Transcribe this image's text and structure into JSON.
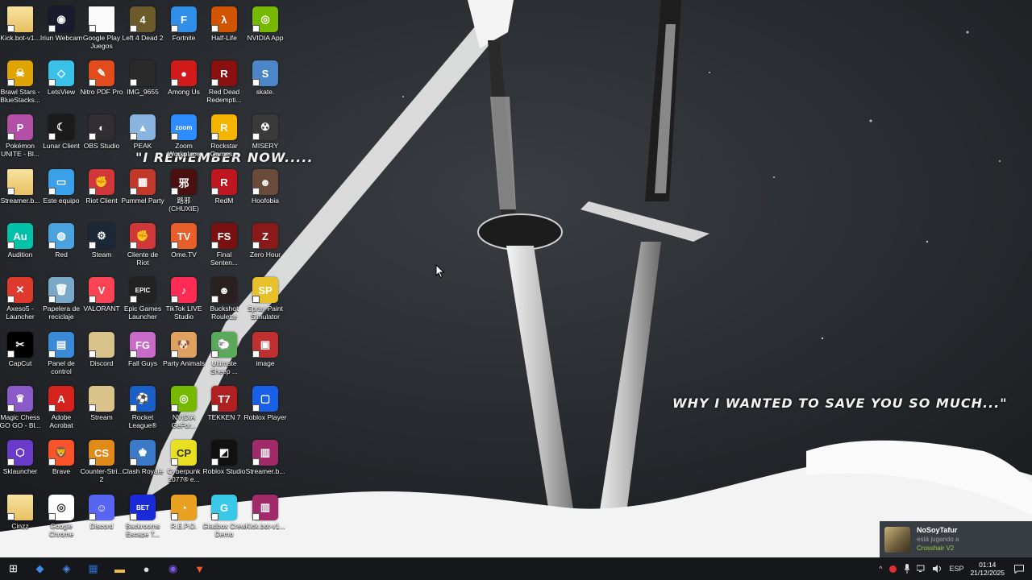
{
  "wallpaper": {
    "quote_top": "\"I REMEMBER NOW.....",
    "quote_bottom": "WHY I WANTED TO SAVE YOU SO MUCH...\""
  },
  "desktop_icons": [
    {
      "label": "Kick.bot-v1...",
      "color": "#f5d98b",
      "glyph": "",
      "icon": "folder-icon"
    },
    {
      "label": "Iriun Webcam",
      "color": "#1a1a2e",
      "glyph": "◉",
      "icon": "webcam-icon"
    },
    {
      "label": "Google Play Juegos",
      "color": "#ffffff",
      "glyph": "",
      "icon": "file-icon"
    },
    {
      "label": "Left 4 Dead 2",
      "color": "#6b5a2a",
      "glyph": "4",
      "icon": "left4dead-icon"
    },
    {
      "label": "Fortnite",
      "color": "#2f8fe8",
      "glyph": "F",
      "icon": "fortnite-icon"
    },
    {
      "label": "Half-Life",
      "color": "#d35400",
      "glyph": "λ",
      "icon": "halflife-icon"
    },
    {
      "label": "NVIDIA App",
      "color": "#76b900",
      "glyph": "◎",
      "icon": "nvidia-icon"
    },
    {
      "label": "Brawl Stars - BlueStacks...",
      "color": "#e0a400",
      "glyph": "☠",
      "icon": "brawlstars-icon"
    },
    {
      "label": "LetsView",
      "color": "#3ac1e8",
      "glyph": "◇",
      "icon": "letsview-icon"
    },
    {
      "label": "Nitro PDF Pro",
      "color": "#e24b1c",
      "glyph": "✎",
      "icon": "nitro-icon"
    },
    {
      "label": "IMG_9655",
      "color": "#2a2a2a",
      "glyph": "",
      "icon": "image-file-icon"
    },
    {
      "label": "Among Us",
      "color": "#d11b1b",
      "glyph": "●",
      "icon": "amongus-icon"
    },
    {
      "label": "Red Dead Redempti...",
      "color": "#8a1010",
      "glyph": "R",
      "icon": "reddead-icon"
    },
    {
      "label": "skate.",
      "color": "#4a86c8",
      "glyph": "S",
      "icon": "skate-icon"
    },
    {
      "label": "Pokémon UNITE - Bl...",
      "color": "#b44fa8",
      "glyph": "P",
      "icon": "pokemon-icon"
    },
    {
      "label": "Lunar Client",
      "color": "#1b1b1b",
      "glyph": "☾",
      "icon": "lunar-icon"
    },
    {
      "label": "OBS Studio",
      "color": "#302e31",
      "glyph": "◐",
      "icon": "obs-icon"
    },
    {
      "label": "PEAK",
      "color": "#8ab4e0",
      "glyph": "▲",
      "icon": "peak-icon"
    },
    {
      "label": "Zoom Workplace",
      "color": "#2d8cff",
      "glyph": "zoom",
      "icon": "zoom-icon"
    },
    {
      "label": "Rockstar Games...",
      "color": "#f4b400",
      "glyph": "R",
      "icon": "rockstar-icon"
    },
    {
      "label": "MISERY",
      "color": "#3a3a3a",
      "glyph": "☢",
      "icon": "misery-icon"
    },
    {
      "label": "Streamer.b...",
      "color": "#f5d98b",
      "glyph": "",
      "icon": "folder-icon"
    },
    {
      "label": "Este equipo",
      "color": "#3aa0e8",
      "glyph": "▭",
      "icon": "computer-icon"
    },
    {
      "label": "Riot Client",
      "color": "#d13639",
      "glyph": "✊",
      "icon": "riot-icon"
    },
    {
      "label": "Pummel Party",
      "color": "#c0392b",
      "glyph": "▦",
      "icon": "pummel-icon"
    },
    {
      "label": "路邪 (CHUXIE)",
      "color": "#4a1010",
      "glyph": "邪",
      "icon": "chuxie-icon"
    },
    {
      "label": "RedM",
      "color": "#c0161f",
      "glyph": "R",
      "icon": "redm-icon"
    },
    {
      "label": "Hoofobia",
      "color": "#6a4a3a",
      "glyph": "☻",
      "icon": "hoofobia-icon"
    },
    {
      "label": "Audition",
      "color": "#00c2a8",
      "glyph": "Au",
      "icon": "audition-icon"
    },
    {
      "label": "Red",
      "color": "#4aa3df",
      "glyph": "◍",
      "icon": "network-icon"
    },
    {
      "label": "Steam",
      "color": "#1b2838",
      "glyph": "⚙",
      "icon": "steam-icon"
    },
    {
      "label": "Cliente de Riot",
      "color": "#d13639",
      "glyph": "✊",
      "icon": "riot-icon"
    },
    {
      "label": "Ome.TV",
      "color": "#e85d2a",
      "glyph": "TV",
      "icon": "ometv-icon"
    },
    {
      "label": "Final Senten...",
      "color": "#7a1010",
      "glyph": "FS",
      "icon": "finalsentence-icon"
    },
    {
      "label": "Zero Hour",
      "color": "#8a1a1a",
      "glyph": "Z",
      "icon": "zerohour-icon"
    },
    {
      "label": "Axeso5 - Launcher",
      "color": "#e03a2e",
      "glyph": "✕",
      "icon": "axeso5-icon"
    },
    {
      "label": "Papelera de reciclaje",
      "color": "#7aa8c8",
      "glyph": "🗑",
      "icon": "recycle-bin-icon"
    },
    {
      "label": "VALORANT",
      "color": "#fa4454",
      "glyph": "V",
      "icon": "valorant-icon"
    },
    {
      "label": "Epic Games Launcher",
      "color": "#222222",
      "glyph": "EPIC",
      "icon": "epic-icon"
    },
    {
      "label": "TikTok LIVE Studio",
      "color": "#fe2c55",
      "glyph": "♪",
      "icon": "tiktok-icon"
    },
    {
      "label": "Buckshot Roulette",
      "color": "#2a2020",
      "glyph": "☻",
      "icon": "buckshot-icon"
    },
    {
      "label": "Spray Paint Simulator",
      "color": "#e8c02a",
      "glyph": "SP",
      "icon": "spraypaint-icon"
    },
    {
      "label": "CapCut",
      "color": "#000000",
      "glyph": "✂",
      "icon": "capcut-icon"
    },
    {
      "label": "Panel de control",
      "color": "#3a8ad8",
      "glyph": "▤",
      "icon": "control-panel-icon"
    },
    {
      "label": "Discord",
      "color": "#d9c38a",
      "glyph": "",
      "icon": "archive-icon"
    },
    {
      "label": "Fall Guys",
      "color": "#c86ac8",
      "glyph": "FG",
      "icon": "fallguys-icon"
    },
    {
      "label": "Party Animals",
      "color": "#e0a060",
      "glyph": "🐶",
      "icon": "partyanimals-icon"
    },
    {
      "label": "Ultimate Sheep ...",
      "color": "#5aa85a",
      "glyph": "🐑",
      "icon": "sheep-icon"
    },
    {
      "label": "image",
      "color": "#c03030",
      "glyph": "▣",
      "icon": "image-icon"
    },
    {
      "label": "Magic Chess GO GO - Bl...",
      "color": "#8a5ac8",
      "glyph": "♛",
      "icon": "magicchess-icon"
    },
    {
      "label": "Adobe Acrobat",
      "color": "#d4231c",
      "glyph": "A",
      "icon": "acrobat-icon"
    },
    {
      "label": "Stream",
      "color": "#d9c38a",
      "glyph": "",
      "icon": "archive-icon"
    },
    {
      "label": "Rocket League®",
      "color": "#1a5fc8",
      "glyph": "⚽",
      "icon": "rocketleague-icon"
    },
    {
      "label": "NVIDIA GeFor...",
      "color": "#76b900",
      "glyph": "◎",
      "icon": "geforce-icon"
    },
    {
      "label": "TEKKEN 7",
      "color": "#b02020",
      "glyph": "T7",
      "icon": "tekken-icon"
    },
    {
      "label": "Roblox Player",
      "color": "#1a5fe8",
      "glyph": "▢",
      "icon": "roblox-player-icon"
    },
    {
      "label": "Sklauncher",
      "color": "#6a3ac8",
      "glyph": "⬡",
      "icon": "sklauncher-icon"
    },
    {
      "label": "Brave",
      "color": "#fb542b",
      "glyph": "🦁",
      "icon": "brave-icon"
    },
    {
      "label": "Counter-Stri... 2",
      "color": "#e08a1a",
      "glyph": "CS",
      "icon": "counterstrike-icon"
    },
    {
      "label": "Clash Royale",
      "color": "#3a7ac8",
      "glyph": "♚",
      "icon": "clashroyale-icon"
    },
    {
      "label": "Cyberpunk 2077® e...",
      "color": "#e8e020",
      "glyph": "CP",
      "icon": "cyberpunk-icon"
    },
    {
      "label": "Roblox Studio",
      "color": "#111111",
      "glyph": "◩",
      "icon": "roblox-studio-icon"
    },
    {
      "label": "Streamer.b...",
      "color": "#a02a6a",
      "glyph": "▥",
      "icon": "winrar-icon"
    },
    {
      "label": "Cinzz",
      "color": "#f5d98b",
      "glyph": "",
      "icon": "folder-icon"
    },
    {
      "label": "Google Chrome",
      "color": "#ffffff",
      "glyph": "◎",
      "icon": "chrome-icon"
    },
    {
      "label": "Discord",
      "color": "#5865f2",
      "glyph": "☺",
      "icon": "discord-icon"
    },
    {
      "label": "Backrooms Escape T...",
      "color": "#1a2ad8",
      "glyph": "BET",
      "icon": "backrooms-icon"
    },
    {
      "label": "R.E.P.O.",
      "color": "#e8a020",
      "glyph": "◔",
      "icon": "repo-icon"
    },
    {
      "label": "Gladbox Crew Demo",
      "color": "#3ac8e8",
      "glyph": "G",
      "icon": "gladbox-icon"
    },
    {
      "label": "Kick.bot-v1...",
      "color": "#a02a6a",
      "glyph": "▥",
      "icon": "winrar-icon"
    }
  ],
  "notification": {
    "user": "NoSoyTafur",
    "status": "está jugando a",
    "game": "Crosshair V2"
  },
  "taskbar": {
    "apps": [
      {
        "name": "start-button",
        "glyph": "⊞",
        "color": "#ffffff"
      },
      {
        "name": "taskbar-app-1",
        "glyph": "◆",
        "color": "#3a8ae8"
      },
      {
        "name": "taskbar-app-2",
        "glyph": "◈",
        "color": "#4a8ae8"
      },
      {
        "name": "taskbar-app-3",
        "glyph": "▦",
        "color": "#2a6ac8"
      },
      {
        "name": "taskbar-file-explorer",
        "glyph": "▬",
        "color": "#f0c040"
      },
      {
        "name": "taskbar-app-5",
        "glyph": "●",
        "color": "#dddddd"
      },
      {
        "name": "taskbar-app-6",
        "glyph": "◉",
        "color": "#7a5ae8"
      },
      {
        "name": "taskbar-brave",
        "glyph": "▼",
        "color": "#fb542b"
      }
    ],
    "tray": {
      "chevron": "^",
      "language": "ESP",
      "time": "01:14",
      "date": "21/12/2025"
    }
  },
  "colors": {
    "taskbar_bg": "#15171a",
    "notif_game": "#8fce48"
  }
}
